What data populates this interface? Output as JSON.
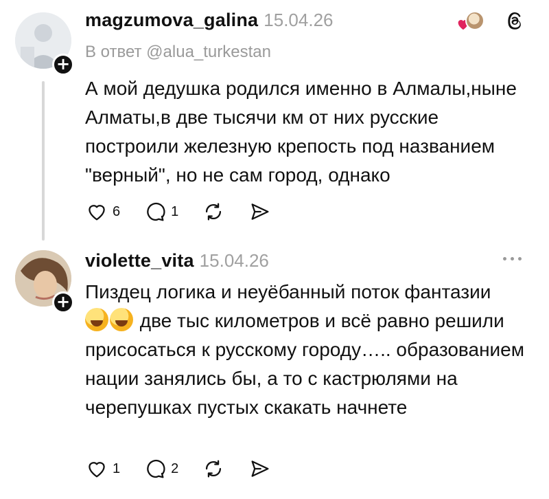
{
  "posts": [
    {
      "username": "magzumova_galina",
      "date": "15.04.26",
      "reply_to": "В ответ @alua_turkestan",
      "text": "А мой дедушка родился именно в Алмалы,ныне Алматы,в две тысячи км от них русские построили железную крепость под названием \"верный\", но не сам город, однако",
      "likes": "6",
      "comments": "1"
    },
    {
      "username": "violette_vita",
      "date": "15.04.26",
      "text_after_emoji": "две тыс километров и всё равно решили присосаться к русскому городу….. образованием нации занялись бы, а то с кастрюлями на черепушках пустых скакать начнете",
      "text_before_emoji": "Пиздец логика и неуёбанный поток фантазии",
      "likes": "1",
      "comments": "2"
    }
  ],
  "icons": {
    "like": "heart-outline-icon",
    "comment": "speech-bubble-icon",
    "repost": "repost-arrows-icon",
    "share": "paper-plane-icon",
    "threads": "threads-logo-icon",
    "more": "more-dots-icon"
  },
  "colors": {
    "text": "#111111",
    "muted": "#a0a0a0",
    "heart": "#e0245e"
  }
}
